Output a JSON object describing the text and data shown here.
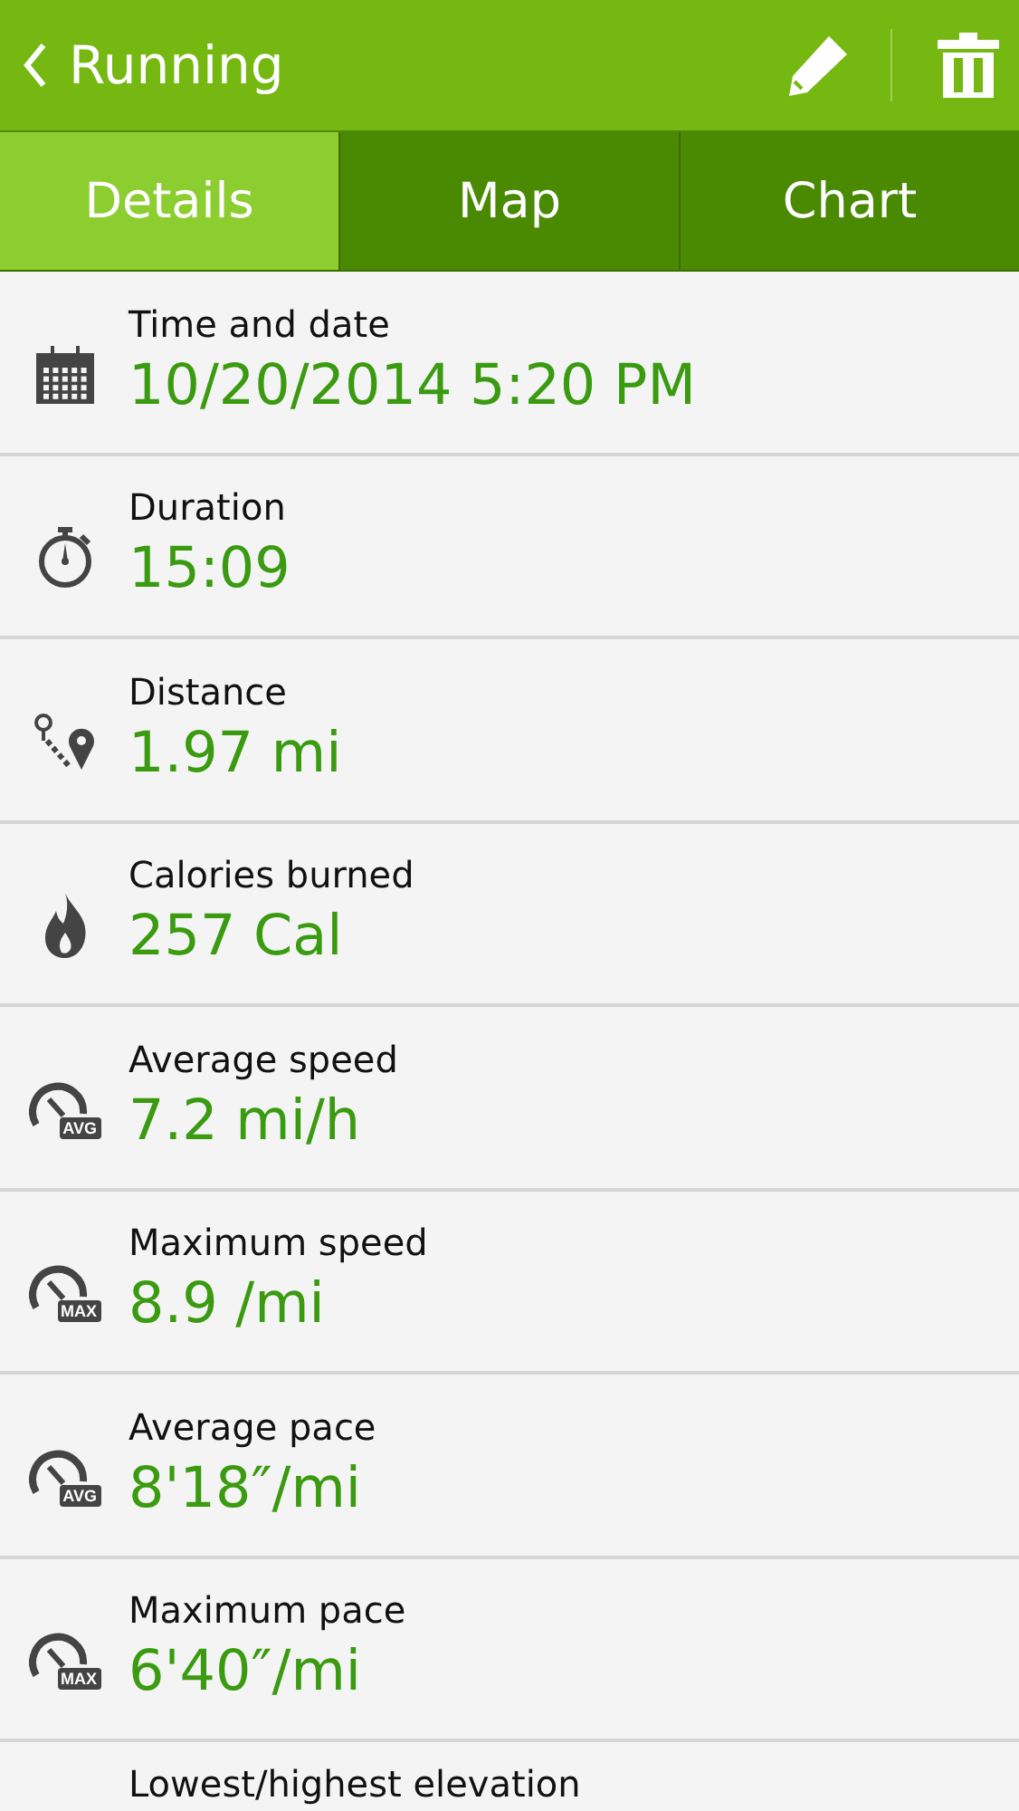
{
  "header": {
    "title": "Running"
  },
  "tabs": [
    {
      "label": "Details",
      "selected": true
    },
    {
      "label": "Map",
      "selected": false
    },
    {
      "label": "Chart",
      "selected": false
    }
  ],
  "rows": [
    {
      "kind": "calendar",
      "label": "Time and date",
      "value": "10/20/2014 5:20 PM"
    },
    {
      "kind": "stopwatch",
      "label": "Duration",
      "value": "15:09"
    },
    {
      "kind": "route",
      "label": "Distance",
      "value": "1.97 mi"
    },
    {
      "kind": "flame",
      "label": "Calories burned",
      "value": "257 Cal"
    },
    {
      "kind": "gauge",
      "badge": "AVG",
      "label": "Average speed",
      "value": "7.2 mi/h"
    },
    {
      "kind": "gauge",
      "badge": "MAX",
      "label": "Maximum speed",
      "value": "8.9 /mi"
    },
    {
      "kind": "gauge",
      "badge": "AVG",
      "label": "Average pace",
      "value": "8'18″/mi"
    },
    {
      "kind": "gauge",
      "badge": "MAX",
      "label": "Maximum pace",
      "value": "6'40″/mi"
    },
    {
      "kind": "none",
      "label": "Lowest/highest elevation"
    }
  ]
}
